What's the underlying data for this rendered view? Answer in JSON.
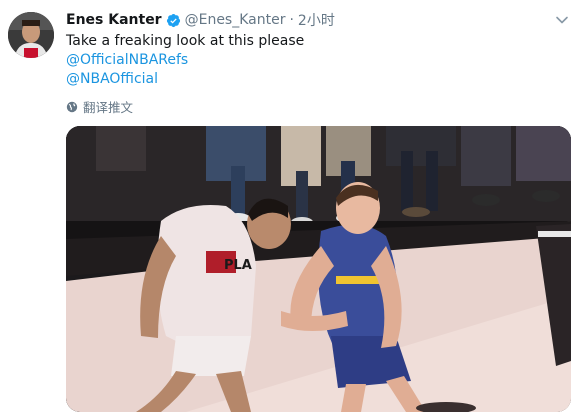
{
  "tweet": {
    "author_name": "Enes Kanter",
    "author_handle": "@Enes_Kanter",
    "separator": "·",
    "timestamp": "2小时",
    "text_line1": "Take a freaking look at this please",
    "mention1": "@OfficialNBARefs",
    "mention2": "@NBAOfficial",
    "translate_label": "翻译推文",
    "jersey_text": "PLA"
  },
  "icons": {
    "verified": "verified-badge-icon",
    "more": "chevron-down-icon",
    "translate": "globe-icon"
  },
  "colors": {
    "link": "#1b95e0",
    "muted": "#657786",
    "text": "#14171a"
  }
}
